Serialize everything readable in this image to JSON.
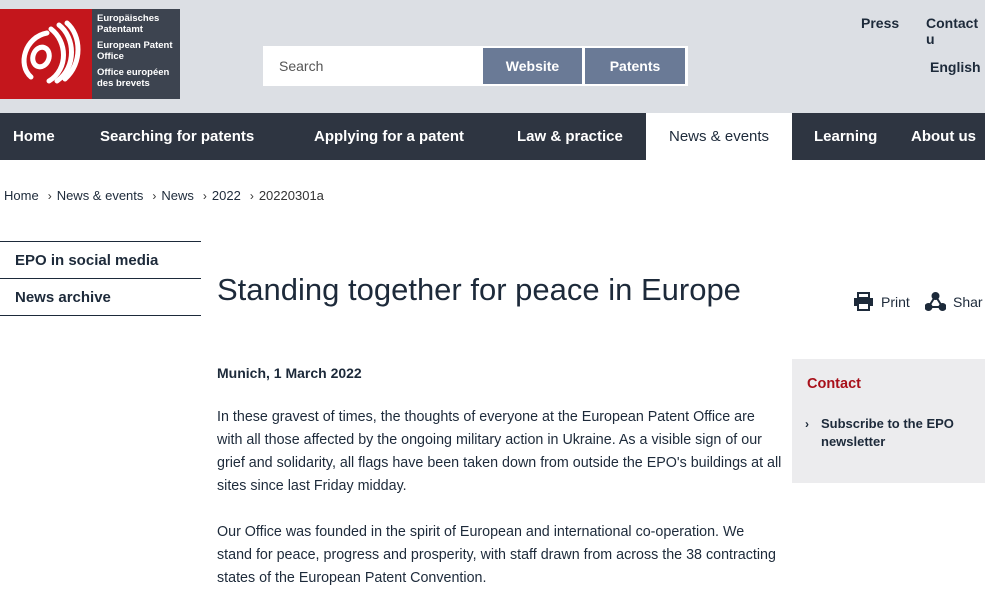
{
  "header": {
    "logo_lines": [
      "Europäisches Patentamt",
      "European Patent Office",
      "Office européen des brevets"
    ],
    "search_placeholder": "Search",
    "search_buttons": [
      "Website",
      "Patents"
    ],
    "top_links": [
      "Press",
      "Contact u"
    ],
    "language": "English"
  },
  "nav": {
    "items": [
      "Home",
      "Searching for patents",
      "Applying for a patent",
      "Law & practice",
      "News & events",
      "Learning",
      "About us"
    ],
    "active": "News & events"
  },
  "breadcrumb": [
    "Home",
    "News & events",
    "News",
    "2022",
    "20220301a"
  ],
  "sidebar": {
    "items": [
      "EPO in social media",
      "News archive"
    ]
  },
  "article": {
    "title": "Standing together for peace in Europe",
    "tools": [
      "Print",
      "Shar"
    ],
    "dateline": "Munich, 1 March 2022",
    "paragraphs": [
      "In these gravest of times, the thoughts of everyone at the European Patent Office are with all those affected by the ongoing military action in Ukraine. As a visible sign of our grief and solidarity, all flags have been taken down from outside the EPO's buildings at all sites since last Friday midday.",
      "Our Office was founded in the spirit of European and international co-operation. We stand for peace, progress and prosperity, with staff drawn from across the 38 contracting states of the European Patent Convention."
    ]
  },
  "contact_box": {
    "title": "Contact",
    "link": "Subscribe to the EPO newsletter"
  },
  "colors": {
    "nav_bg": "#2e3541",
    "header_bg": "#dcdfe4",
    "brand_red": "#c4161c",
    "button_blue": "#6a7a96",
    "contact_title": "#a8101a"
  }
}
